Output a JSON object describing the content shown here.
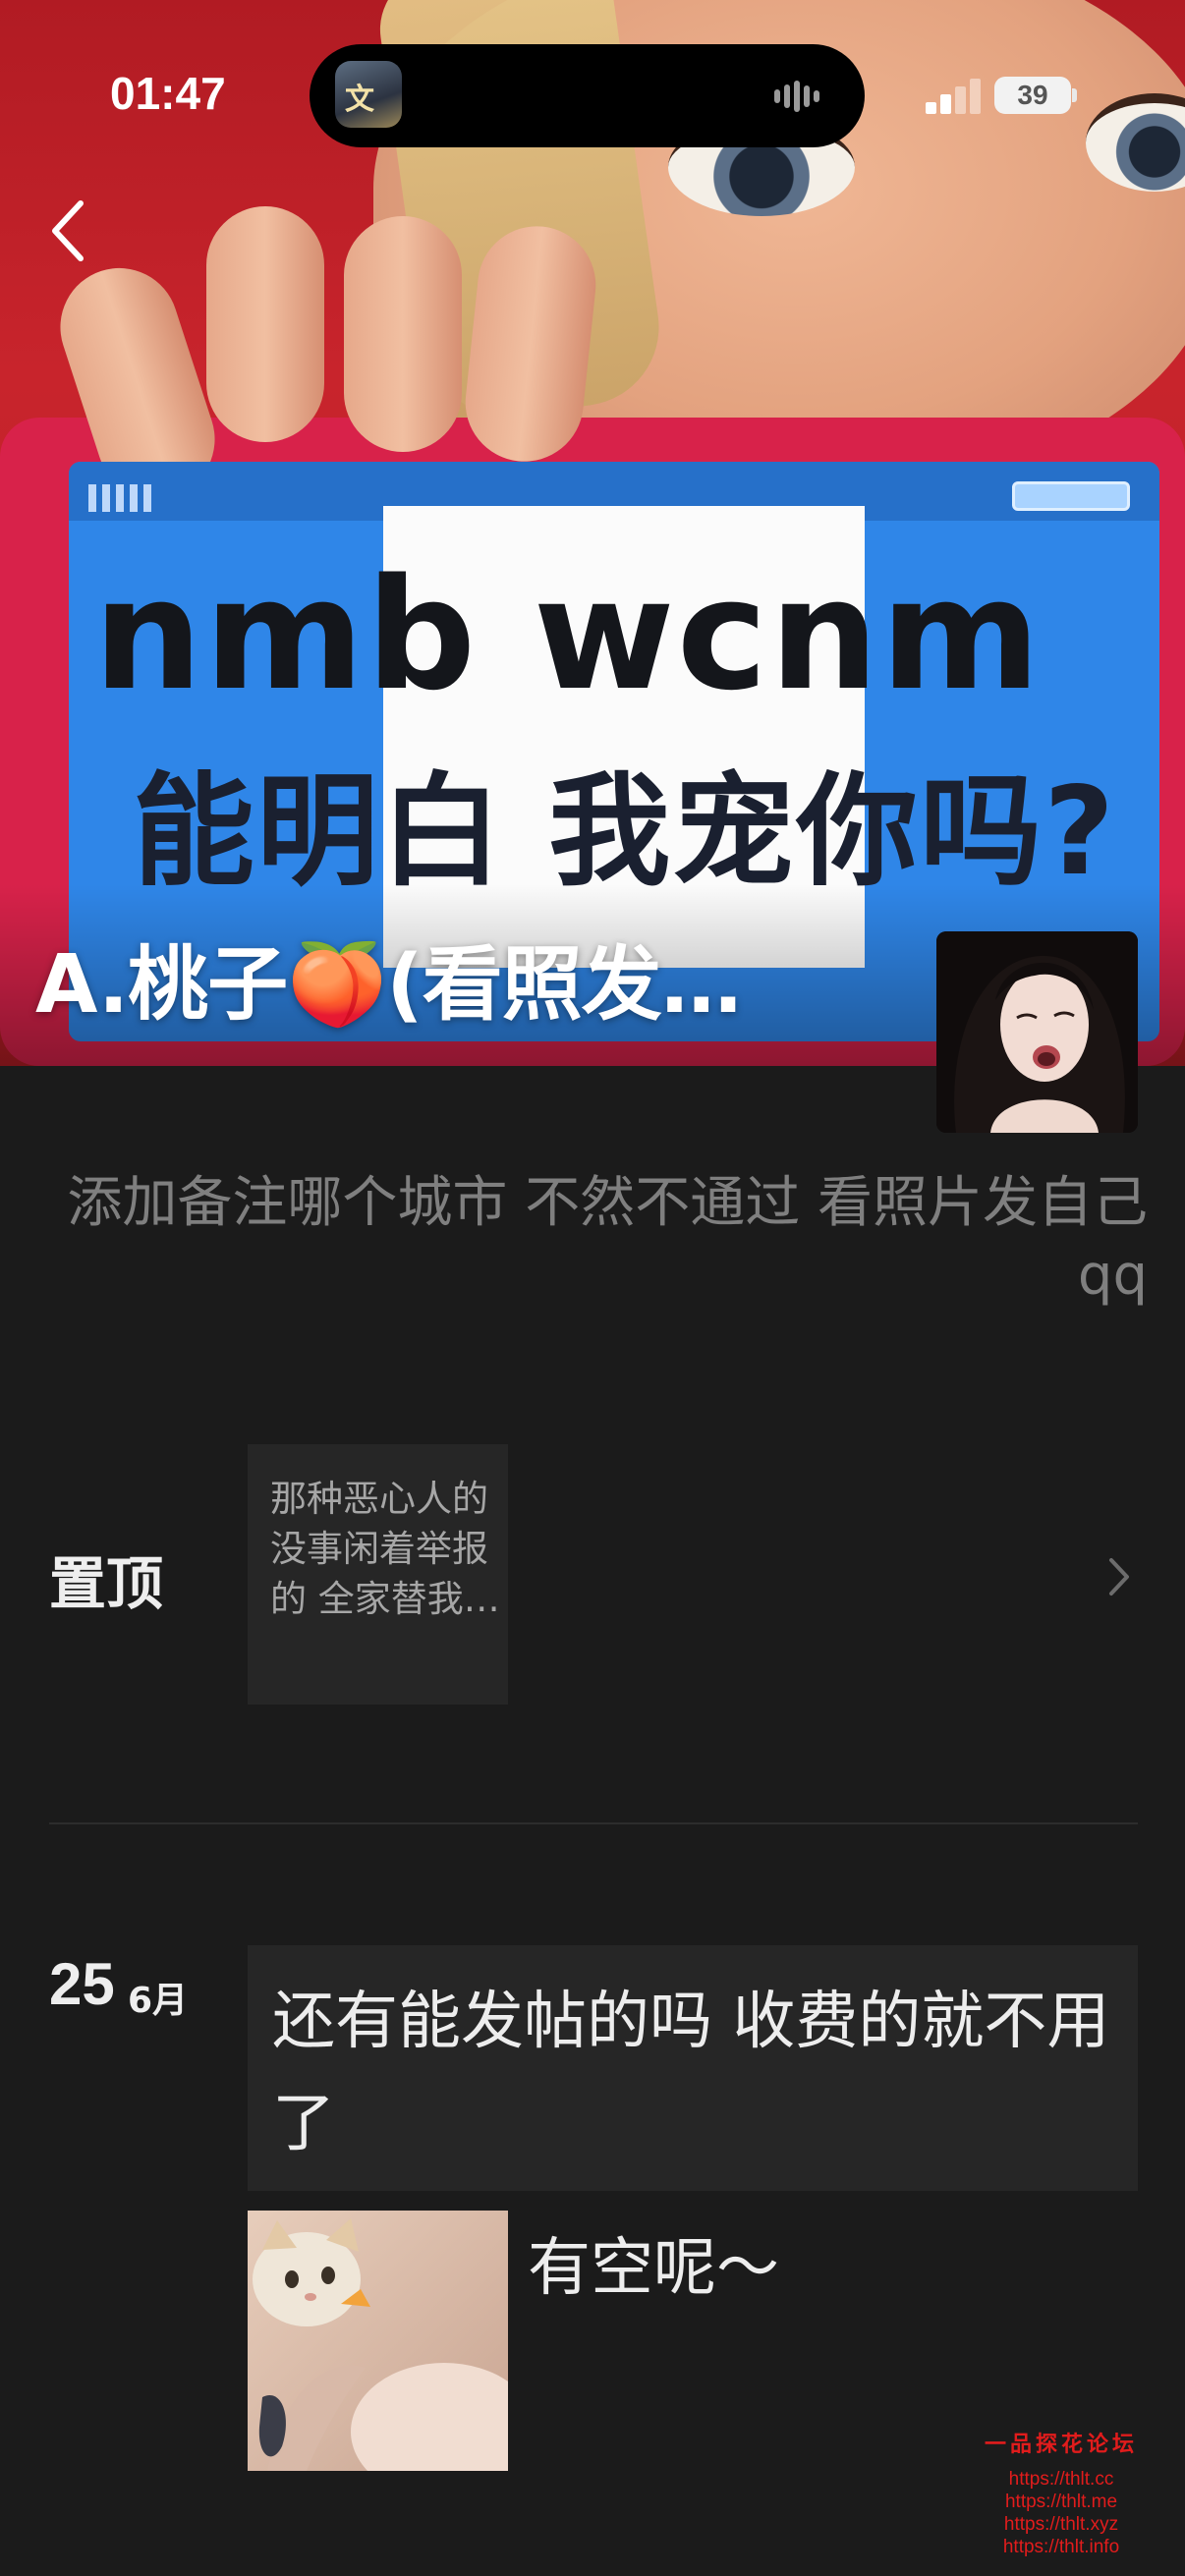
{
  "status_bar": {
    "time": "01:47",
    "battery": "39",
    "island_app_icon": "app-icon"
  },
  "cover": {
    "line1": "nmb wcnm",
    "line2": "能明白 我宠你吗?"
  },
  "profile": {
    "name": "A.桃子🍑(看照发…",
    "signature": "添加备注哪个城市 不然不通过 看照片发自己qq"
  },
  "pinned": {
    "label": "置顶",
    "preview_text": "那种恶心人的 没事闲着举报的 全家替我…"
  },
  "post": {
    "day": "25",
    "month": "6月",
    "text": "还有能发帖的吗 收费的就不用了",
    "caption": "有空呢～"
  },
  "watermark": {
    "title": "一品探花论坛",
    "links": [
      "https://thlt.cc",
      "https://thlt.me",
      "https://thlt.xyz",
      "https://thlt.info"
    ]
  },
  "colors": {
    "background": "#1b1b1b",
    "card": "#262626",
    "secondary_text": "#7f7f7f",
    "watermark": "#e11c1c"
  }
}
